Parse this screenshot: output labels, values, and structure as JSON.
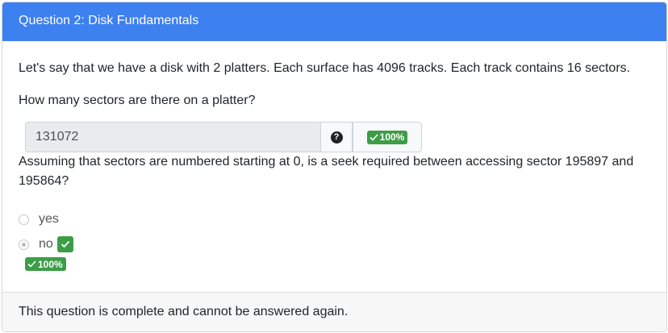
{
  "header": {
    "title": "Question 2: Disk Fundamentals"
  },
  "question": {
    "stem": "Let's say that we have a disk with 2 platters. Each surface has 4096 tracks. Each track contains 16 sectors.",
    "part1": {
      "prompt": "How many sectors are there on a platter?",
      "answer_value": "131072",
      "help_icon": "question-circle-icon",
      "score": "100%"
    },
    "part2": {
      "prompt": "Assuming that sectors are numbered starting at 0, is a seek required between accessing sector 195897 and 195864?",
      "options": [
        {
          "label": "yes",
          "selected": false
        },
        {
          "label": "no",
          "selected": true,
          "correct": true
        }
      ],
      "score": "100%"
    }
  },
  "footer": {
    "message": "This question is complete and cannot be answered again."
  },
  "colors": {
    "header_bg": "#3d80f0",
    "success": "#3d9d47"
  }
}
